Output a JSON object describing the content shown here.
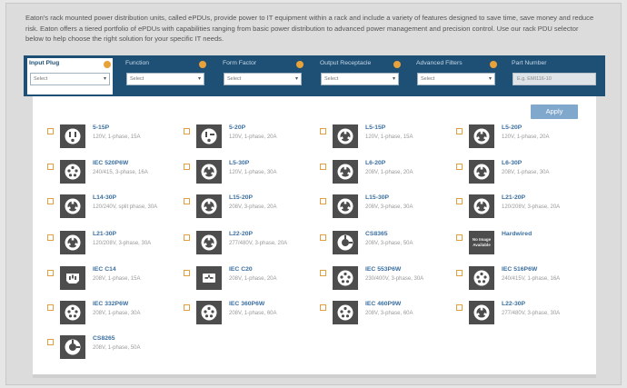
{
  "intro": "Eaton's rack mounted power distribution units, called ePDUs, provide power to IT equipment within a rack and include a variety of features designed to save time, save money and reduce risk. Eaton offers a tiered portfolio of ePDUs with capabilities ranging from basic power distribution to advanced power management and precision control. Use our rack PDU selector below to help choose the right solution for your specific IT needs.",
  "filters": [
    {
      "label": "Input Plug",
      "value": "Select"
    },
    {
      "label": "Function",
      "value": "Select"
    },
    {
      "label": "Form Factor",
      "value": "Select"
    },
    {
      "label": "Output Receptacle",
      "value": "Select"
    },
    {
      "label": "Advanced Filters",
      "value": "Select"
    }
  ],
  "part_number": {
    "label": "Part Number",
    "placeholder": "E.g. EMI116-10"
  },
  "apply_label": "Apply",
  "colors": {
    "filterbar": "#1e4f75",
    "accent": "#e8a23a",
    "link": "#3b6fa0",
    "apply": "#7fa8cc"
  },
  "plugs": [
    {
      "name": "5-15P",
      "desc": "120V, 1-phase, 15A",
      "icon": "nema-5-15p-icon"
    },
    {
      "name": "5-20P",
      "desc": "120V, 1-phase, 20A",
      "icon": "nema-5-20p-icon"
    },
    {
      "name": "L5-15P",
      "desc": "120V, 1-phase, 15A",
      "icon": "twist-lock-icon"
    },
    {
      "name": "L5-20P",
      "desc": "120V, 1-phase, 20A",
      "icon": "twist-lock-icon"
    },
    {
      "name": "IEC 520P6W",
      "desc": "240/415, 3-phase, 16A",
      "icon": "iec-round-icon"
    },
    {
      "name": "L5-30P",
      "desc": "120V, 1-phase, 30A",
      "icon": "twist-lock-icon"
    },
    {
      "name": "L6-20P",
      "desc": "208V, 1-phase, 20A",
      "icon": "twist-lock-icon"
    },
    {
      "name": "L6-30P",
      "desc": "208V, 1-phase, 30A",
      "icon": "twist-lock-icon"
    },
    {
      "name": "L14-30P",
      "desc": "120/240V, split phase, 30A",
      "icon": "twist-lock-icon"
    },
    {
      "name": "L15-20P",
      "desc": "208V, 3-phase, 20A",
      "icon": "twist-lock-icon"
    },
    {
      "name": "L15-30P",
      "desc": "208V, 3-phase, 30A",
      "icon": "twist-lock-icon"
    },
    {
      "name": "L21-20P",
      "desc": "120/208V, 3-phase, 20A",
      "icon": "twist-lock-icon"
    },
    {
      "name": "L21-30P",
      "desc": "120/208V, 3-phase, 30A",
      "icon": "twist-lock-icon"
    },
    {
      "name": "L22-20P",
      "desc": "277/480V, 3-phase, 20A",
      "icon": "twist-lock-icon"
    },
    {
      "name": "CS8365",
      "desc": "208V, 3-phase, 50A",
      "icon": "cs-plug-icon"
    },
    {
      "name": "Hardwired",
      "desc": "",
      "icon": "no-image-icon",
      "noimg": "No Image Available"
    },
    {
      "name": "IEC C14",
      "desc": "208V, 1-phase, 15A",
      "icon": "iec-c14-icon"
    },
    {
      "name": "IEC C20",
      "desc": "208V, 1-phase, 20A",
      "icon": "iec-c20-icon"
    },
    {
      "name": "IEC 553P6W",
      "desc": "230/400V, 3-phase, 30A",
      "icon": "iec-round-icon"
    },
    {
      "name": "IEC 516P6W",
      "desc": "240/415V, 1-phase, 16A",
      "icon": "iec-round-icon"
    },
    {
      "name": "IEC 332P6W",
      "desc": "208V, 1-phase, 30A",
      "icon": "iec-round-icon"
    },
    {
      "name": "IEC 360P6W",
      "desc": "208V, 1-phase, 60A",
      "icon": "iec-round-icon"
    },
    {
      "name": "IEC 460P9W",
      "desc": "208V, 3-phase, 60A",
      "icon": "iec-round-icon"
    },
    {
      "name": "L22-30P",
      "desc": "277/480V, 3-phase, 30A",
      "icon": "twist-lock-icon"
    },
    {
      "name": "CS8265",
      "desc": "208V, 1-phase, 50A",
      "icon": "cs-plug-icon"
    }
  ]
}
